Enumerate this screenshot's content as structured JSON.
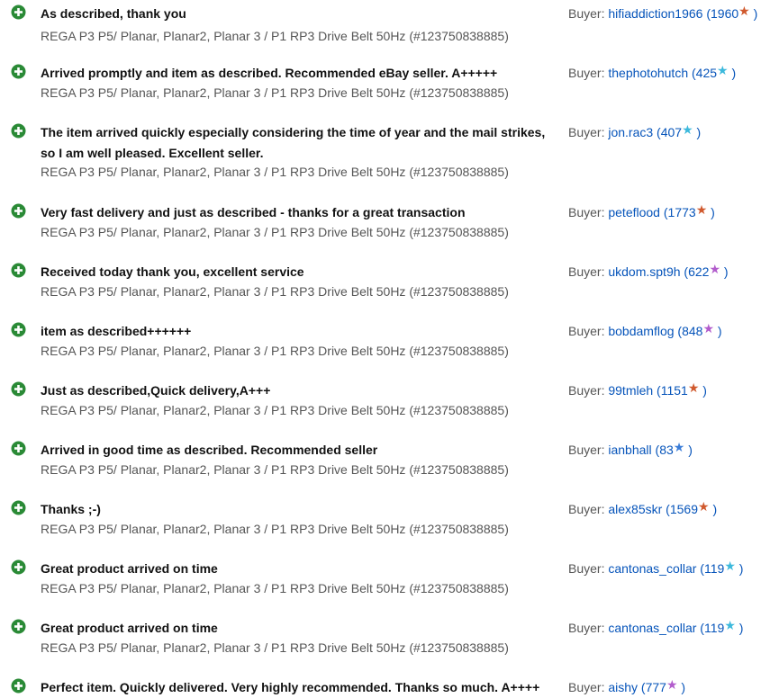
{
  "feedback": {
    "rows": [
      {
        "comment": "As described, thank you",
        "item": "REGA P3 P5/ Planar, Planar2, Planar 3 / P1 RP3 Drive Belt 50Hz (#123750838885)",
        "buyer_prefix": "Buyer: ",
        "buyer_name": "hifiaddiction1966",
        "score": "1960",
        "star_color": "#d0592d"
      },
      {
        "comment": "Arrived promptly and item as described. Recommended eBay seller. A+++++",
        "item": "REGA P3 P5/ Planar, Planar2, Planar 3 / P1 RP3 Drive Belt 50Hz (#123750838885)",
        "buyer_prefix": "Buyer: ",
        "buyer_name": "thephotohutch",
        "score": "425",
        "star_color": "#3cb9dc"
      },
      {
        "comment": "The item arrived quickly especially considering the time of year and the mail strikes, so I am well pleased. Excellent seller.",
        "item": "REGA P3 P5/ Planar, Planar2, Planar 3 / P1 RP3 Drive Belt 50Hz (#123750838885)",
        "buyer_prefix": "Buyer: ",
        "buyer_name": "jon.rac3",
        "score": "407",
        "star_color": "#3cb9dc"
      },
      {
        "comment": "Very fast delivery and just as described - thanks for a great transaction",
        "item": "REGA P3 P5/ Planar, Planar2, Planar 3 / P1 RP3 Drive Belt 50Hz (#123750838885)",
        "buyer_prefix": "Buyer: ",
        "buyer_name": "peteflood",
        "score": "1773",
        "star_color": "#d0592d"
      },
      {
        "comment": "Received today thank you, excellent service",
        "item": "REGA P3 P5/ Planar, Planar2, Planar 3 / P1 RP3 Drive Belt 50Hz (#123750838885)",
        "buyer_prefix": "Buyer: ",
        "buyer_name": "ukdom.spt9h",
        "score": "622",
        "star_color": "#b25ccc"
      },
      {
        "comment": "item as described++++++",
        "item": "REGA P3 P5/ Planar, Planar2, Planar 3 / P1 RP3 Drive Belt 50Hz (#123750838885)",
        "buyer_prefix": "Buyer: ",
        "buyer_name": "bobdamflog",
        "score": "848",
        "star_color": "#b25ccc"
      },
      {
        "comment": "Just as described,Quick delivery,A+++",
        "item": "REGA P3 P5/ Planar, Planar2, Planar 3 / P1 RP3 Drive Belt 50Hz (#123750838885)",
        "buyer_prefix": "Buyer: ",
        "buyer_name": "99tmleh",
        "score": "1151",
        "star_color": "#d0592d"
      },
      {
        "comment": "Arrived in good time as described. Recommended seller",
        "item": "REGA P3 P5/ Planar, Planar2, Planar 3 / P1 RP3 Drive Belt 50Hz (#123750838885)",
        "buyer_prefix": "Buyer: ",
        "buyer_name": "ianbhall",
        "score": "83",
        "star_color": "#3b7dd8"
      },
      {
        "comment": "Thanks ;-)",
        "item": "REGA P3 P5/ Planar, Planar2, Planar 3 / P1 RP3 Drive Belt 50Hz (#123750838885)",
        "buyer_prefix": "Buyer: ",
        "buyer_name": "alex85skr",
        "score": "1569",
        "star_color": "#d0592d"
      },
      {
        "comment": "Great product arrived on time",
        "item": "REGA P3 P5/ Planar, Planar2, Planar 3 / P1 RP3 Drive Belt 50Hz (#123750838885)",
        "buyer_prefix": "Buyer: ",
        "buyer_name": "cantonas_collar",
        "score": "119",
        "star_color": "#3cb9dc"
      },
      {
        "comment": "Great product arrived on time",
        "item": "REGA P3 P5/ Planar, Planar2, Planar 3 / P1 RP3 Drive Belt 50Hz (#123750838885)",
        "buyer_prefix": "Buyer: ",
        "buyer_name": "cantonas_collar",
        "score": "119",
        "star_color": "#3cb9dc"
      },
      {
        "comment": "Perfect item. Quickly delivered. Very highly recommended. Thanks so much. A++++",
        "item": "",
        "buyer_prefix": "Buyer: ",
        "buyer_name": "aishy",
        "score": "777",
        "star_color": "#b25ccc"
      }
    ],
    "positive_icon_color": "#2a8a36",
    "paren_open": " (",
    "paren_close": " )"
  }
}
